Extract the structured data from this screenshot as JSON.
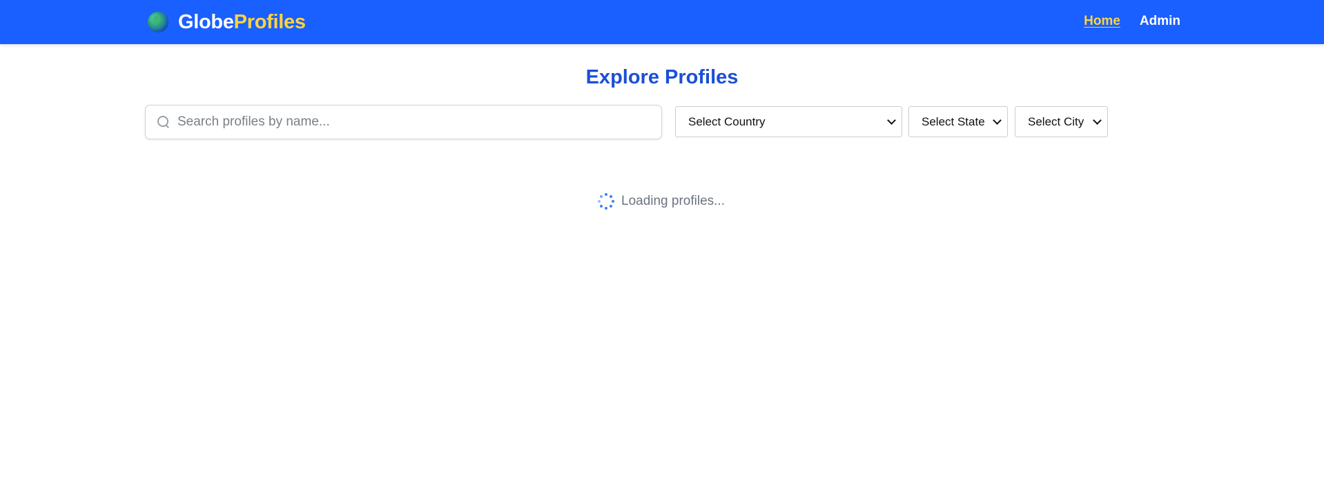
{
  "brand": {
    "part1": "Globe",
    "part2": "Profiles",
    "icon": "globe-icon"
  },
  "nav": {
    "items": [
      {
        "label": "Home",
        "active": true
      },
      {
        "label": "Admin",
        "active": false
      }
    ]
  },
  "page": {
    "title": "Explore Profiles"
  },
  "search": {
    "placeholder": "Search profiles by name...",
    "value": "",
    "icon": "search-icon"
  },
  "filters": {
    "country": "Select Country",
    "state": "Select State",
    "city": "Select City"
  },
  "status": {
    "loading_text": "Loading profiles...",
    "icon": "spinner-icon"
  },
  "colors": {
    "navbar": "#1a5fff",
    "brand_accent": "#ffd43b",
    "title": "#1a4fd6",
    "spinner": "#3b82f6"
  }
}
